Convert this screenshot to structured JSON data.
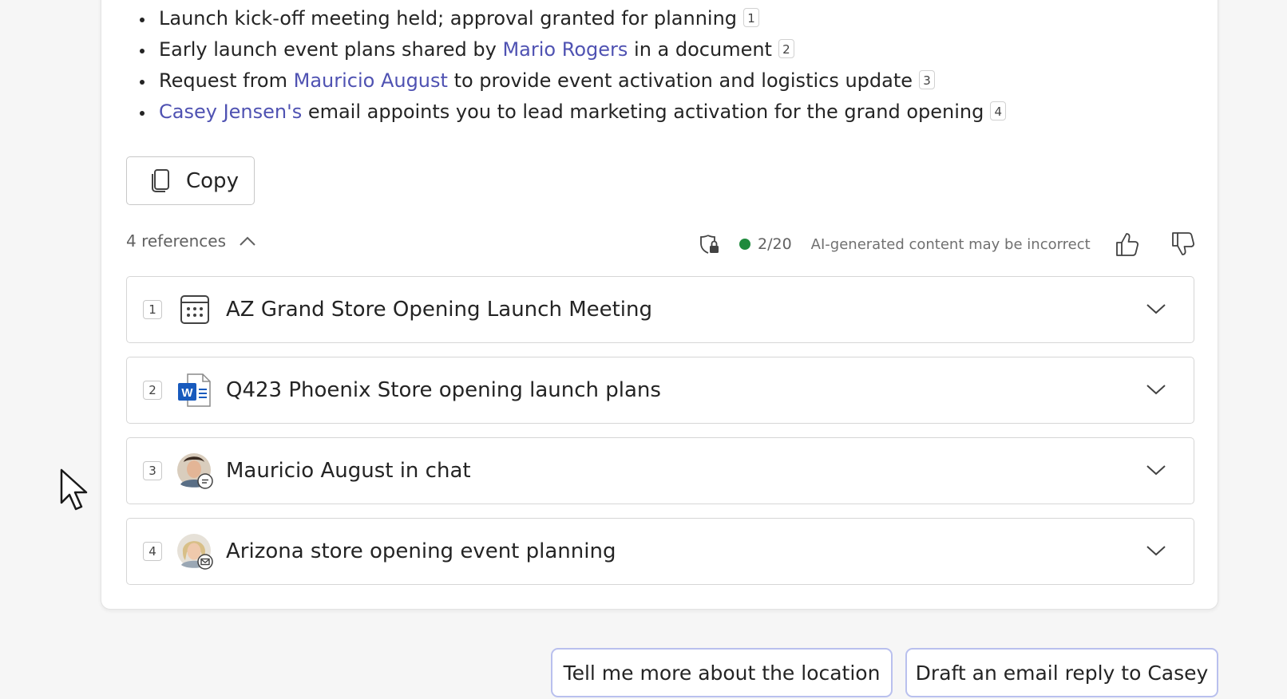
{
  "summary": {
    "bullets": [
      {
        "before": "Launch kick-off meeting held; approval granted for planning",
        "link": "",
        "after": "",
        "cite": "1"
      },
      {
        "before": "Early launch event plans shared by ",
        "link": "Mario Rogers",
        "after": " in a document",
        "cite": "2"
      },
      {
        "before": "Request from ",
        "link": "Mauricio August",
        "after": " to provide event activation and logistics update",
        "cite": "3"
      },
      {
        "before": "",
        "link": "Casey Jensen's",
        "after": " email appoints you to lead marketing activation for the grand opening",
        "cite": "4"
      }
    ]
  },
  "copy_button": {
    "label": "Copy",
    "icon": "copy-icon"
  },
  "references": {
    "toggle_label": "4 references",
    "toggle_icon": "chevron-up-icon",
    "items": [
      {
        "number": "1",
        "title": "AZ Grand Store Opening Launch Meeting",
        "icon": "calendar-icon"
      },
      {
        "number": "2",
        "title": "Q423 Phoenix Store opening launch plans",
        "icon": "word-document-icon"
      },
      {
        "number": "3",
        "title": "Mauricio August in chat",
        "icon": "avatar-chat-icon"
      },
      {
        "number": "4",
        "title": "Arizona store opening event planning",
        "icon": "avatar-email-icon"
      }
    ]
  },
  "status": {
    "usage_count": "2/20",
    "disclaimer": "AI-generated content may be incorrect",
    "dot_color": "#1e8a3c",
    "shield_icon": "shield-lock-icon",
    "like_icon": "thumbs-up-icon",
    "dislike_icon": "thumbs-down-icon"
  },
  "suggestions": [
    {
      "label": "Tell me more about the location"
    },
    {
      "label": "Draft an email reply to Casey"
    }
  ],
  "colors": {
    "link": "#4f52b2",
    "suggestion_border": "#b9c0ee",
    "word_blue": "#185abd"
  }
}
